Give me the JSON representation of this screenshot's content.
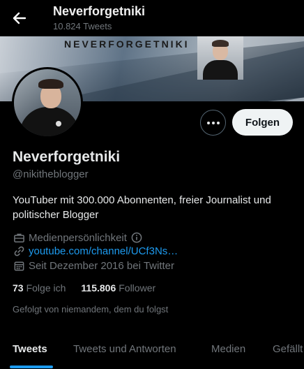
{
  "header": {
    "title": "Neverforgetniki",
    "tweet_count": "10.824 Tweets"
  },
  "banner": {
    "title": "NEVERFORGETNIKI"
  },
  "actions": {
    "follow_label": "Folgen"
  },
  "profile": {
    "name": "Neverforgetniki",
    "handle": "@nikitheblogger",
    "bio": "YouTuber mit 300.000 Abonnenten, freier Journalist und politischer Blogger",
    "category": "Medienpersönlichkeit",
    "link": "youtube.com/channel/UCf3Ns…",
    "joined": "Seit Dezember 2016 bei Twitter",
    "following_count": "73",
    "following_label": "Folge ich",
    "followers_count": "115.806",
    "followers_label": "Follower",
    "followed_by": "Gefolgt von niemandem, dem du folgst"
  },
  "tabs": [
    {
      "label": "Tweets"
    },
    {
      "label": "Tweets und Antworten"
    },
    {
      "label": "Medien"
    },
    {
      "label": "Gefällt mir"
    }
  ],
  "colors": {
    "accent": "#1d9bf0",
    "background": "#000000",
    "muted_text": "#71767b"
  }
}
